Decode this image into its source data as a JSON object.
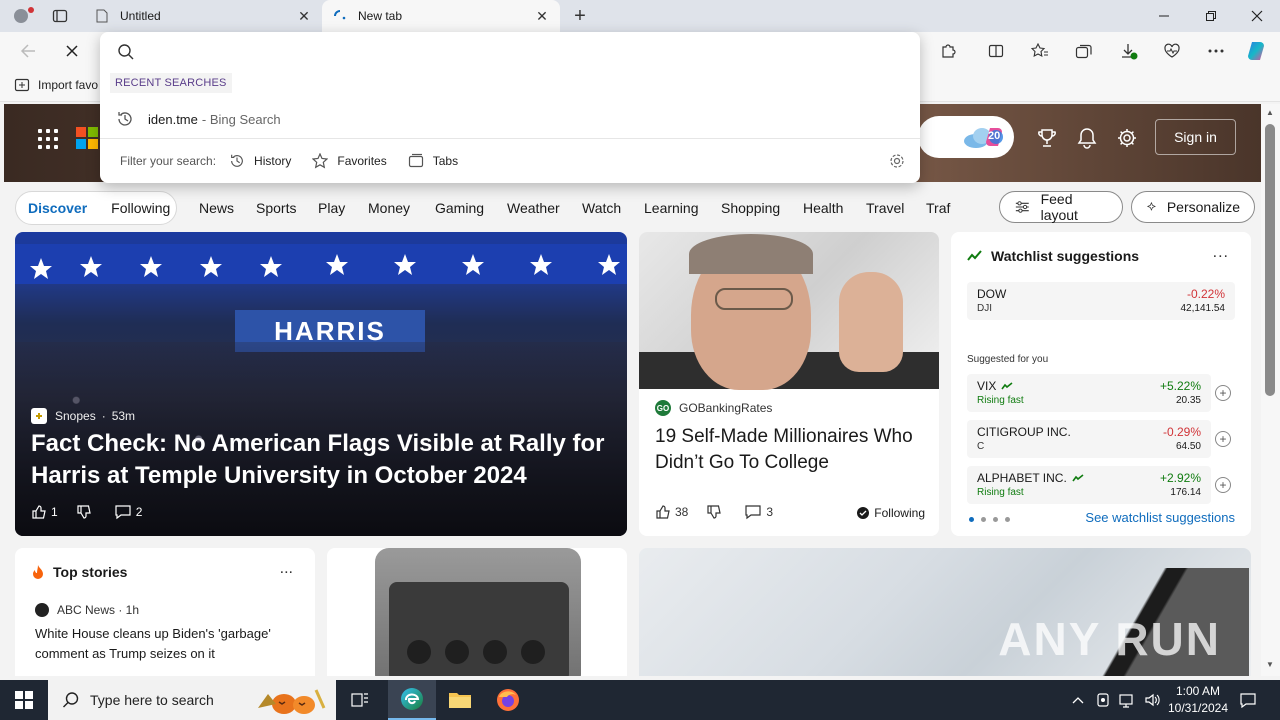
{
  "browser": {
    "tabs": [
      {
        "label": "Untitled",
        "active": false
      },
      {
        "label": "New tab",
        "active": true
      }
    ],
    "favorites_bar": {
      "import_label": "Import favo"
    },
    "window_controls": [
      "minimize",
      "restore",
      "close"
    ]
  },
  "omnibox": {
    "value": "",
    "recent_label": "RECENT SEARCHES",
    "recent": [
      {
        "query": "iden.tme",
        "source": "- Bing Search"
      }
    ],
    "filter_label": "Filter your search:",
    "filters": [
      "History",
      "Favorites",
      "Tabs"
    ]
  },
  "header": {
    "copilot_badge": "20",
    "signin_label": "Sign in"
  },
  "nav": {
    "segments": [
      "Discover",
      "Following"
    ],
    "links": [
      "News",
      "Sports",
      "Play",
      "Money",
      "Gaming",
      "Weather",
      "Watch",
      "Learning",
      "Shopping",
      "Health",
      "Travel",
      "Traf"
    ],
    "feed_layout_label": "Feed layout",
    "personalize_label": "Personalize"
  },
  "hero": {
    "source": "Snopes",
    "age": "53m",
    "banner": "HARRIS",
    "title": "Fact Check: No American Flags Visible at Rally for Harris at Temple University in October 2024",
    "likes": "1",
    "comments": "2"
  },
  "gates": {
    "source": "GOBankingRates",
    "source_logo": "GO",
    "title": "19 Self-Made Millionaires Who Didn’t Go To College",
    "likes": "38",
    "comments": "3",
    "following_label": "Following"
  },
  "watchlist": {
    "title": "Watchlist suggestions",
    "more": "...",
    "main": {
      "symbol": "DOW",
      "sub": "DJI",
      "change": "-0.22%",
      "price": "42,141.54"
    },
    "suggested_label": "Suggested for you",
    "suggested": [
      {
        "symbol": "VIX",
        "sub": "Rising fast",
        "change": "+5.22%",
        "price": "20.35",
        "direction": "up"
      },
      {
        "symbol": "CITIGROUP INC.",
        "sub": "C",
        "change": "-0.29%",
        "price": "64.50",
        "direction": "down"
      },
      {
        "symbol": "ALPHABET INC.",
        "sub": "Rising fast",
        "change": "+2.92%",
        "price": "176.14",
        "direction": "up"
      }
    ],
    "see_label": "See watchlist suggestions"
  },
  "top_stories": {
    "title": "Top stories",
    "more": "...",
    "source": "ABC News · 1h",
    "headline": "White House cleans up Biden's 'garbage' comment as Trump seizes on it"
  },
  "watermark": "ANY RUN",
  "taskbar": {
    "search_placeholder": "Type here to search",
    "time": "1:00 AM",
    "date": "10/31/2024"
  },
  "colors": {
    "accent": "#0f6cbd",
    "negative": "#d13438",
    "positive": "#107c10",
    "taskbar": "#1f2733"
  }
}
